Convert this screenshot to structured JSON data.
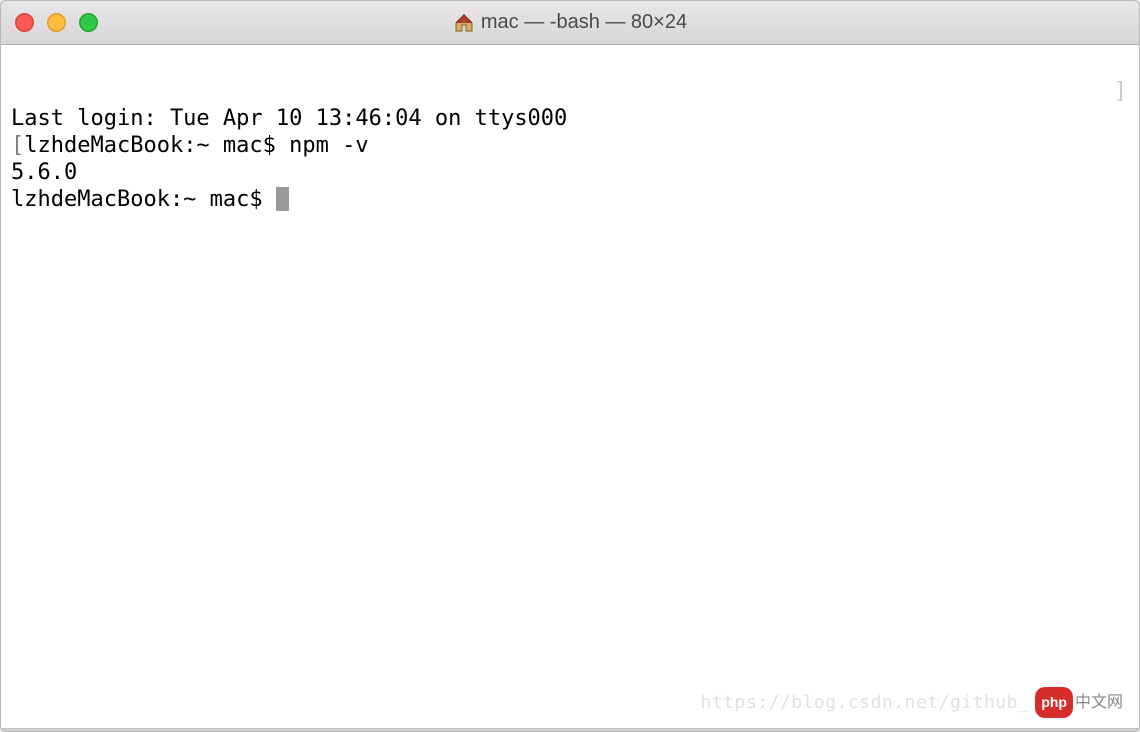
{
  "window": {
    "title": "mac — -bash — 80×24"
  },
  "terminal": {
    "lines": {
      "last_login": "Last login: Tue Apr 10 13:46:04 on ttys000",
      "prompt1_host": "lzhdeMacBook:~ mac$ ",
      "command1": "npm -v",
      "output1": "5.6.0",
      "prompt2": "lzhdeMacBook:~ mac$ "
    }
  },
  "watermark": {
    "url": "https://blog.csdn.net/github_",
    "badge": "php",
    "cn": "中文网"
  }
}
